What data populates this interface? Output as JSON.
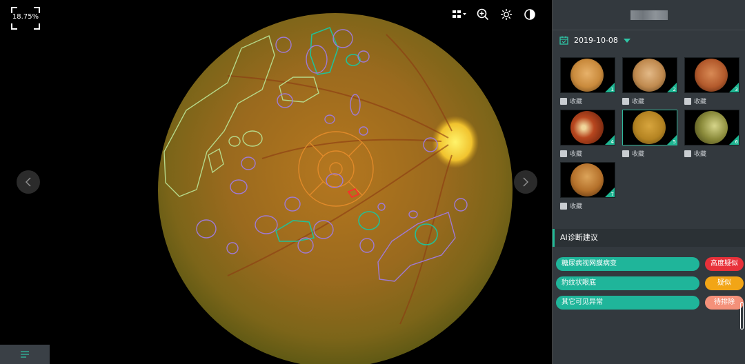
{
  "viewer": {
    "zoom": "18.75%",
    "tools": [
      {
        "name": "layout-grid-icon"
      },
      {
        "name": "zoom-in-icon"
      },
      {
        "name": "brightness-icon"
      },
      {
        "name": "contrast-icon"
      }
    ],
    "nav": {
      "prev_icon": "chevron-left-icon",
      "next_icon": "chevron-right-icon"
    },
    "menu_icon": "list-icon"
  },
  "panel": {
    "date": "2019-10-08",
    "thumbnails": [
      {
        "num": "1",
        "fav": "收藏",
        "color": "#c98a3c"
      },
      {
        "num": "2",
        "fav": "收藏",
        "color": "#c08a4f"
      },
      {
        "num": "3",
        "fav": "收藏",
        "color": "#b35a2c"
      },
      {
        "num": "4",
        "fav": "收藏",
        "color": "#b8471f"
      },
      {
        "num": "5",
        "fav": "收藏",
        "color": "#b58422"
      },
      {
        "num": "6",
        "fav": "收藏",
        "color": "#8a8a3a"
      },
      {
        "num": "7",
        "fav": "收藏",
        "color": "#b4702a"
      }
    ],
    "ai": {
      "title": "AI诊断建议",
      "items": [
        {
          "label": "糖尿病视网膜病变",
          "badge": "高度疑似",
          "badge_color": "#e8313a"
        },
        {
          "label": "豹纹状眼底",
          "badge": "疑似",
          "badge_color": "#f2a516"
        },
        {
          "label": "其它可见异常",
          "badge": "待排除",
          "badge_color": "#f4917a"
        }
      ]
    }
  },
  "colors": {
    "accent": "#1fb59a",
    "panel_bg": "#33393e"
  }
}
